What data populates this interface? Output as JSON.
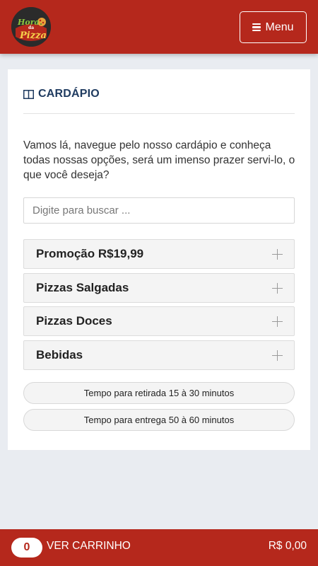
{
  "header": {
    "logo_text": {
      "line1": "Hora",
      "line2": "da",
      "line3": "Pizza"
    },
    "menu_label": "Menu",
    "colors": {
      "brand": "#b5281c"
    }
  },
  "section": {
    "title": "CARDÁPIO",
    "intro": "Vamos lá, navegue pelo nosso cardápio e conheça todas nossas opções, será um imenso prazer servi-lo, o que você deseja?",
    "search_placeholder": "Digite para buscar ..."
  },
  "categories": [
    {
      "label": "Promoção R$19,99",
      "icon": "plus-icon"
    },
    {
      "label": "Pizzas Salgadas",
      "icon": "plus-icon"
    },
    {
      "label": "Pizzas Doces",
      "icon": "plus-icon"
    },
    {
      "label": "Bebidas",
      "icon": "plus-icon"
    }
  ],
  "info": {
    "pickup": "Tempo para retirada 15 à 30 minutos",
    "delivery": "Tempo para entrega 50 à 60 minutos"
  },
  "cart": {
    "count": "0",
    "label": "VER CARRINHO",
    "total": "R$ 0,00"
  }
}
